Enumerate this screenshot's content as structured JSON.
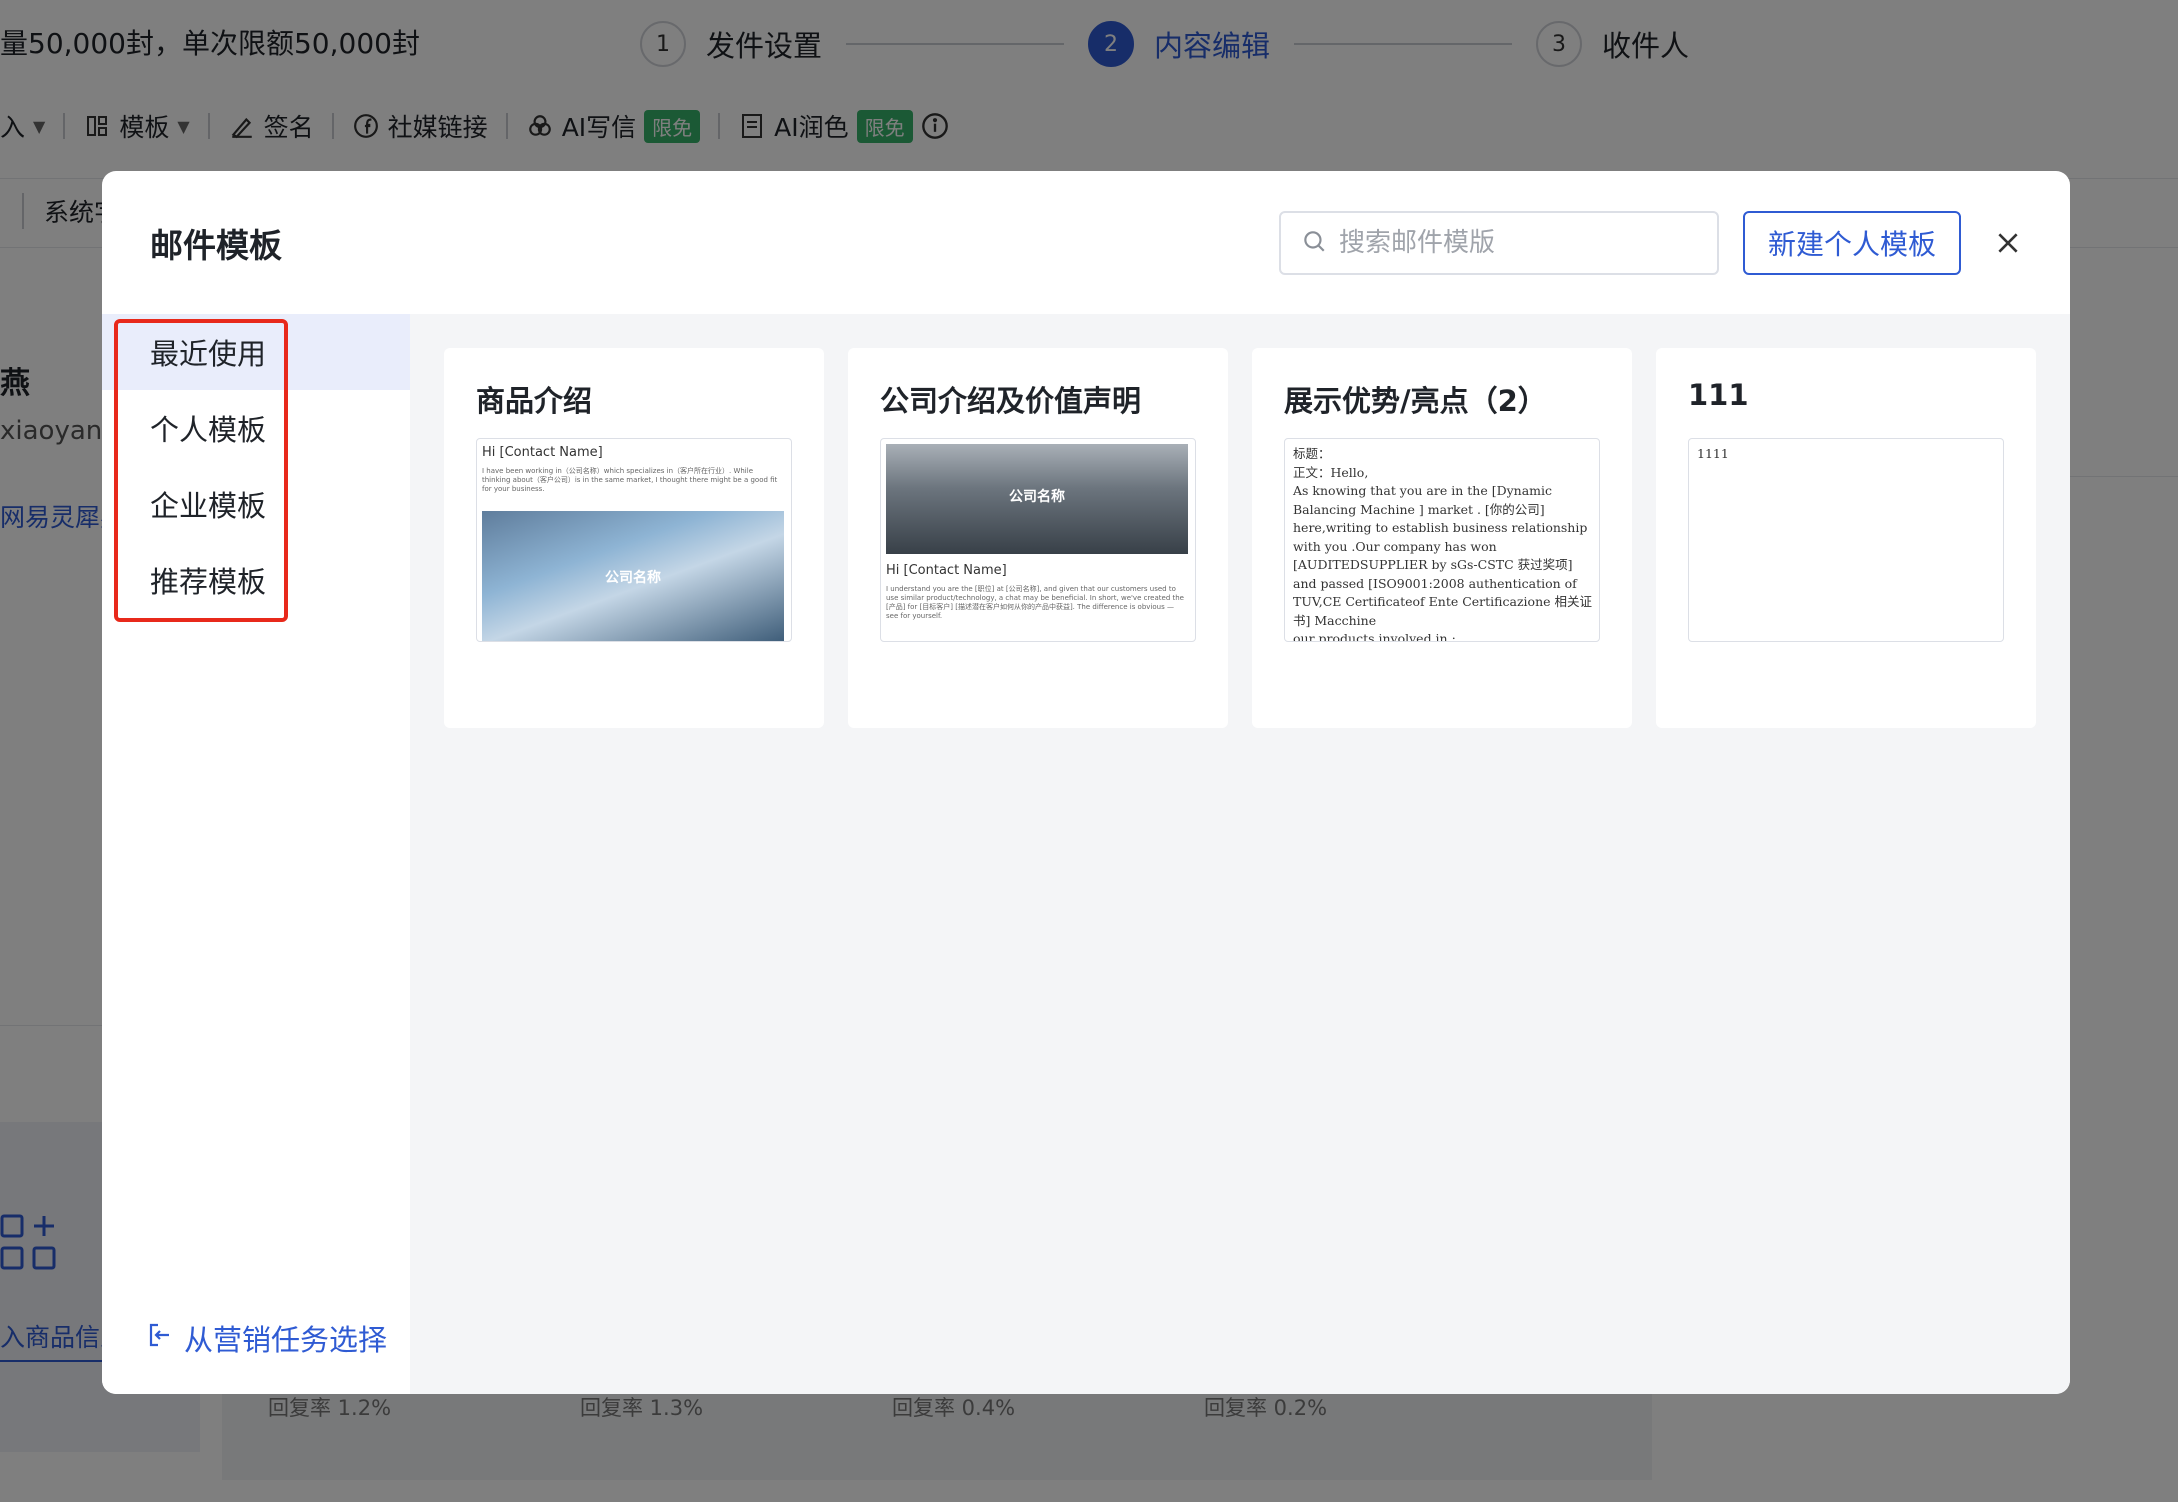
{
  "background": {
    "quota_text": "量50,000封，单次限额50,000封",
    "steps": [
      {
        "num": "1",
        "label": "发件设置"
      },
      {
        "num": "2",
        "label": "内容编辑"
      },
      {
        "num": "3",
        "label": "收件人"
      }
    ],
    "toolbar": {
      "insert_label": "入",
      "template_label": "模板",
      "signature_label": "签名",
      "social_label": "社媒链接",
      "ai_write_label": "AI写信",
      "ai_polish_label": "AI润色",
      "free_badge": "限免"
    },
    "row2_label": "系统字",
    "side_name": "燕",
    "side_email": "xiaoyan(",
    "side_link": "网易灵犀办",
    "product_info": "入商品信息",
    "stats": [
      "回复率 1.2%",
      "回复率 1.3%",
      "回复率 0.4%",
      "回复率 0.2%"
    ]
  },
  "modal": {
    "title": "邮件模板",
    "search_placeholder": "搜索邮件模版",
    "new_button": "新建个人模板",
    "nav": [
      {
        "label": "最近使用",
        "active": true
      },
      {
        "label": "个人模板",
        "active": false
      },
      {
        "label": "企业模板",
        "active": false
      },
      {
        "label": "推荐模板",
        "active": false
      }
    ],
    "from_task": "从营销任务选择",
    "templates": [
      {
        "name": "商品介绍",
        "preview_greeting": "Hi [Contact Name]",
        "preview_body": "I have been working in（公司名称）which specializes in（客户所在行业）. While thinking about（客户公司）is in the same market, I thought there might be a good fit for your business.",
        "preview_image_label": "公司名称"
      },
      {
        "name": "公司介绍及价值声明",
        "preview_image_label": "公司名称",
        "preview_greeting": "Hi [Contact Name]",
        "preview_body": "I understand you are the [职位] at [公司名称], and given that our customers used to use similar product/technology, a chat may be beneficial. In short, we've created the [产品] for [目标客户] [描述潜在客户如何从你的产品中获益]. The difference is obvious — see for yourself."
      },
      {
        "name": "展示优势/亮点（2）",
        "preview_lines": [
          "标题：",
          "正文：Hello,",
          "As knowing that you are in the [Dynamic",
          "Balancing Machine ] market . [你的公司]",
          "here,writing to establish business relationship",
          "with you .Our company has won",
          "[AUDITEDSUPPLIER by sGs-CSTC 获过奖项]",
          "and passed [ISO9001:2008 authentication of",
          "TUV,CE Certificateof Ente Certificazione 相关证",
          "书] Macchine",
          "our products involved in :"
        ]
      },
      {
        "name": "111",
        "preview_text": "1111"
      }
    ]
  },
  "colors": {
    "accent": "#2f5bd3",
    "highlight": "#e8291b",
    "free_badge": "#37b36a"
  }
}
